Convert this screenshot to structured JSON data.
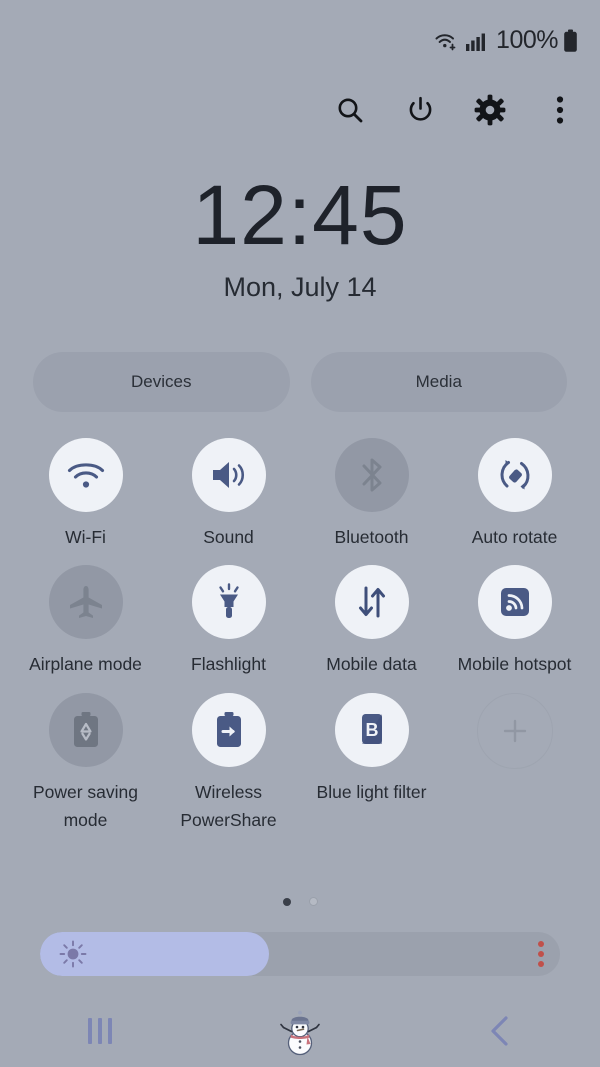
{
  "status_bar": {
    "wifi_icon": "wifi-signal-icon",
    "cellular_icon": "cellular-signal-icon",
    "battery_percent": "100%",
    "battery_icon": "battery-full-icon"
  },
  "toolbar": {
    "items": [
      {
        "name": "search-icon",
        "label": "Search"
      },
      {
        "name": "power-icon",
        "label": "Power"
      },
      {
        "name": "settings-gear-icon",
        "label": "Settings"
      },
      {
        "name": "overflow-menu-icon",
        "label": "More options"
      }
    ]
  },
  "clock": {
    "time": "12:45",
    "date": "Mon, July 14"
  },
  "pills": [
    {
      "label": "Devices",
      "name": "devices-button"
    },
    {
      "label": "Media",
      "name": "media-button"
    }
  ],
  "quick_settings": {
    "rows": [
      [
        {
          "label": "Wi-Fi",
          "icon": "wifi-icon",
          "state": "on"
        },
        {
          "label": "Sound",
          "icon": "sound-icon",
          "state": "on"
        },
        {
          "label": "Bluetooth",
          "icon": "bluetooth-icon",
          "state": "off"
        },
        {
          "label": "Auto rotate",
          "icon": "auto-rotate-icon",
          "state": "on"
        }
      ],
      [
        {
          "label": "Airplane mode",
          "icon": "airplane-icon",
          "state": "off"
        },
        {
          "label": "Flashlight",
          "icon": "flashlight-icon",
          "state": "on"
        },
        {
          "label": "Mobile data",
          "icon": "mobile-data-icon",
          "state": "on"
        },
        {
          "label": "Mobile hotspot",
          "icon": "mobile-hotspot-icon",
          "state": "on"
        }
      ],
      [
        {
          "label": "Power saving mode",
          "icon": "power-saving-icon",
          "state": "off"
        },
        {
          "label": "Wireless PowerShare",
          "icon": "wireless-powershare-icon",
          "state": "on"
        },
        {
          "label": "Blue light filter",
          "icon": "blue-light-filter-icon",
          "state": "on"
        },
        {
          "label": "",
          "icon": "add-tile-icon",
          "state": "add"
        }
      ]
    ]
  },
  "page_indicator": {
    "total": 2,
    "current": 1
  },
  "brightness": {
    "name": "brightness-slider",
    "value_percent": 44,
    "sun_icon": "brightness-sun-icon",
    "menu_icon": "brightness-options-icon"
  },
  "nav_bar": {
    "recents": "recents-icon",
    "home": "home-snowman-icon",
    "back": "back-chevron-icon"
  },
  "colors": {
    "background": "#a4aab6",
    "tile_on": "#eff2f7",
    "tile_off": "#9298a5",
    "icon_blue": "#4a5a85",
    "slider_fill": "#b3bce6",
    "accent_red": "#c0504a"
  }
}
